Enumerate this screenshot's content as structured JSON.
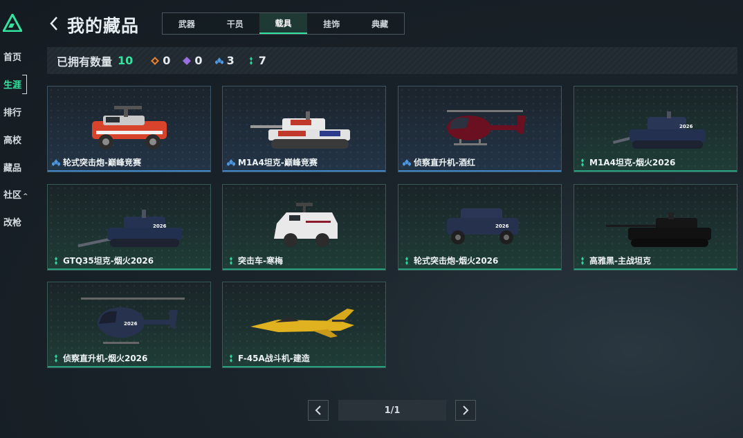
{
  "sidebar": {
    "items": [
      {
        "label": "首页"
      },
      {
        "label": "生涯"
      },
      {
        "label": "排行"
      },
      {
        "label": "高校"
      },
      {
        "label": "藏品"
      },
      {
        "label": "社区"
      },
      {
        "label": "改枪"
      }
    ],
    "active": "生涯",
    "community_chevron": "^"
  },
  "header": {
    "title": "我的藏品",
    "tabs": [
      {
        "label": "武器"
      },
      {
        "label": "干员"
      },
      {
        "label": "载具"
      },
      {
        "label": "挂饰"
      },
      {
        "label": "典藏"
      }
    ],
    "active_tab": "载具"
  },
  "stats": {
    "label": "已拥有数量",
    "total": "10",
    "counts": [
      {
        "icon": "orange-diamond-icon",
        "value": "0",
        "color": "#d9803a"
      },
      {
        "icon": "purple-diamond-icon",
        "value": "0",
        "color": "#9a6de0"
      },
      {
        "icon": "blue-triple-icon",
        "value": "3",
        "color": "#4d98e0"
      },
      {
        "icon": "green-dots-icon",
        "value": "7",
        "color": "#2fd39a"
      }
    ]
  },
  "items": [
    {
      "name": "轮式突击炮-巅峰竞赛",
      "rarity": "blue",
      "vehicle": "wheeled-assault-gun"
    },
    {
      "name": "M1A4坦克-巅峰竞赛",
      "rarity": "blue",
      "vehicle": "tank"
    },
    {
      "name": "侦察直升机-酒红",
      "rarity": "blue",
      "vehicle": "helicopter"
    },
    {
      "name": "M1A4坦克-烟火2026",
      "rarity": "green",
      "vehicle": "tank"
    },
    {
      "name": "GTQ35坦克-烟火2026",
      "rarity": "green",
      "vehicle": "tank"
    },
    {
      "name": "突击车-寒梅",
      "rarity": "green",
      "vehicle": "assault-vehicle"
    },
    {
      "name": "轮式突击炮-烟火2026",
      "rarity": "green",
      "vehicle": "wheeled-assault-gun"
    },
    {
      "name": "高雅黑-主战坦克",
      "rarity": "green",
      "vehicle": "tank"
    },
    {
      "name": "侦察直升机-烟火2026",
      "rarity": "green",
      "vehicle": "helicopter"
    },
    {
      "name": "F-45A战斗机-建造",
      "rarity": "green",
      "vehicle": "fighter-jet"
    }
  ],
  "pagination": {
    "display": "1/1"
  },
  "colors": {
    "accent": "#35e3a0",
    "blue_rarity": "#4d98e0",
    "green_rarity": "#2fd39a"
  }
}
